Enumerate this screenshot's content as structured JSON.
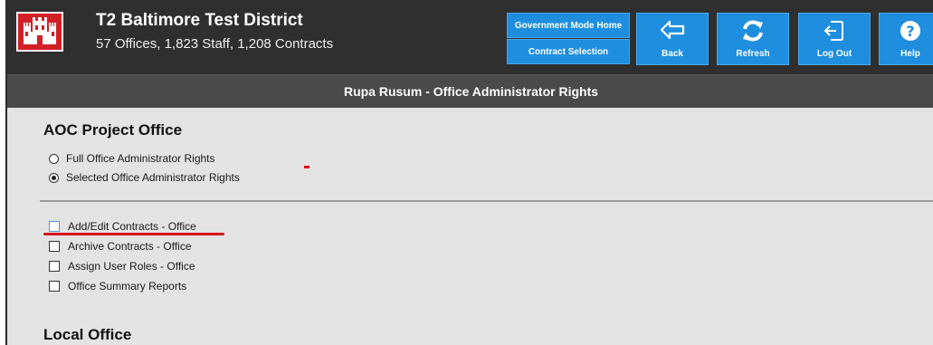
{
  "header": {
    "app_title": "T2 Baltimore Test District",
    "app_subtitle": "57 Offices, 1,823 Staff, 1,208 Contracts",
    "brand_color": "#1f8ede",
    "logo_icon": "castle-icon"
  },
  "nav": {
    "government_mode_home": "Government Mode Home",
    "contract_selection": "Contract Selection"
  },
  "toolbar": {
    "back": {
      "label": "Back",
      "icon": "back-arrow-icon"
    },
    "refresh": {
      "label": "Refresh",
      "icon": "refresh-icon"
    },
    "logout": {
      "label": "Log Out",
      "icon": "logout-icon"
    },
    "help": {
      "label": "Help",
      "icon": "help-icon"
    }
  },
  "page": {
    "title": "Rupa Rusum - Office Administrator Rights"
  },
  "sections": [
    {
      "heading": "AOC Project Office",
      "rights_options": [
        {
          "label": "Full Office Administrator Rights",
          "selected": false
        },
        {
          "label": "Selected Office Administrator Rights",
          "selected": true
        }
      ],
      "permissions": [
        {
          "label": "Add/Edit Contracts - Office",
          "checked": false
        },
        {
          "label": "Archive Contracts - Office",
          "checked": false
        },
        {
          "label": "Assign User Roles - Office",
          "checked": false
        },
        {
          "label": "Office Summary Reports",
          "checked": false
        }
      ]
    },
    {
      "heading": "Local Office"
    }
  ],
  "annotation_color": "#d5141c"
}
